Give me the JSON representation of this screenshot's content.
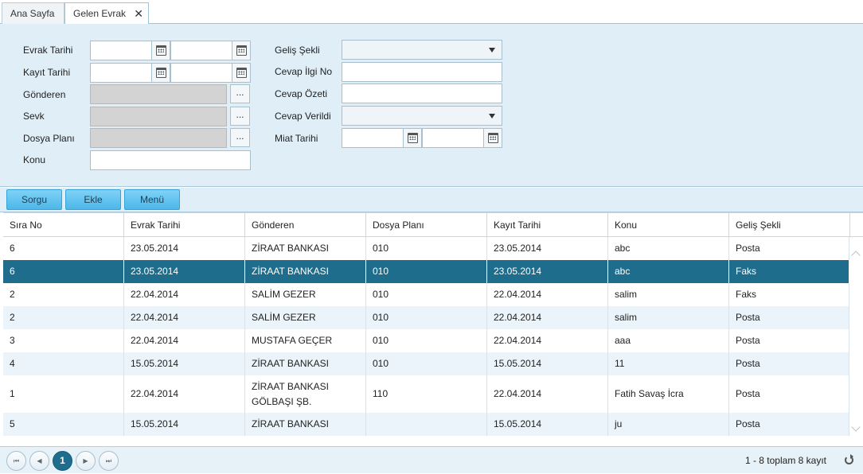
{
  "tabs": [
    {
      "label": "Ana Sayfa"
    },
    {
      "label": "Gelen Evrak",
      "close": "✕"
    }
  ],
  "form": {
    "evrak_tarihi": "Evrak Tarihi",
    "kayit_tarihi": "Kayıt Tarihi",
    "gonderen": "Gönderen",
    "sevk": "Sevk",
    "dosya_plani": "Dosya Planı",
    "konu": "Konu",
    "gelis_sekli": "Geliş Şekli",
    "cevap_ilgi_no": "Cevap İlgi No",
    "cevap_ozeti": "Cevap Özeti",
    "cevap_verildi": "Cevap Verildi",
    "miat_tarihi": "Miat Tarihi",
    "browse_label": "..."
  },
  "toolbar": {
    "sorgu": "Sorgu",
    "ekle": "Ekle",
    "menu": "Menü"
  },
  "table": {
    "columns": [
      "Sıra No",
      "Evrak Tarihi",
      "Gönderen",
      "Dosya Planı",
      "Kayıt Tarihi",
      "Konu",
      "Geliş Şekli"
    ],
    "rows": [
      [
        "6",
        "23.05.2014",
        "ZİRAAT BANKASI",
        "010",
        "23.05.2014",
        "abc",
        "Posta"
      ],
      [
        "6",
        "23.05.2014",
        "ZİRAAT BANKASI",
        "010",
        "23.05.2014",
        "abc",
        "Faks"
      ],
      [
        "2",
        "22.04.2014",
        "SALİM GEZER",
        "010",
        "22.04.2014",
        "salim",
        "Faks"
      ],
      [
        "2",
        "22.04.2014",
        "SALİM GEZER",
        "010",
        "22.04.2014",
        "salim",
        "Posta"
      ],
      [
        "3",
        "22.04.2014",
        "MUSTAFA GEÇER",
        "010",
        "22.04.2014",
        "aaa",
        "Posta"
      ],
      [
        "4",
        "15.05.2014",
        "ZİRAAT BANKASI",
        "010",
        "15.05.2014",
        "11",
        "Posta"
      ],
      [
        "1",
        "22.04.2014",
        "ZİRAAT BANKASI GÖLBAŞI ŞB.",
        "110",
        "22.04.2014",
        "Fatih Savaş İcra",
        "Posta"
      ],
      [
        "5",
        "15.05.2014",
        "ZİRAAT BANKASI",
        "",
        "15.05.2014",
        "ju",
        "Posta"
      ]
    ],
    "selected_row": 1
  },
  "pager": {
    "first": "⏮",
    "prev": "◀",
    "current": "1",
    "next": "▶",
    "last": "⏭",
    "info": "1 - 8 toplam 8 kayıt"
  },
  "colors": {
    "panel_bg": "#dfeef7",
    "selected_row": "#1f6d8c",
    "button": "#4cb7ea"
  }
}
